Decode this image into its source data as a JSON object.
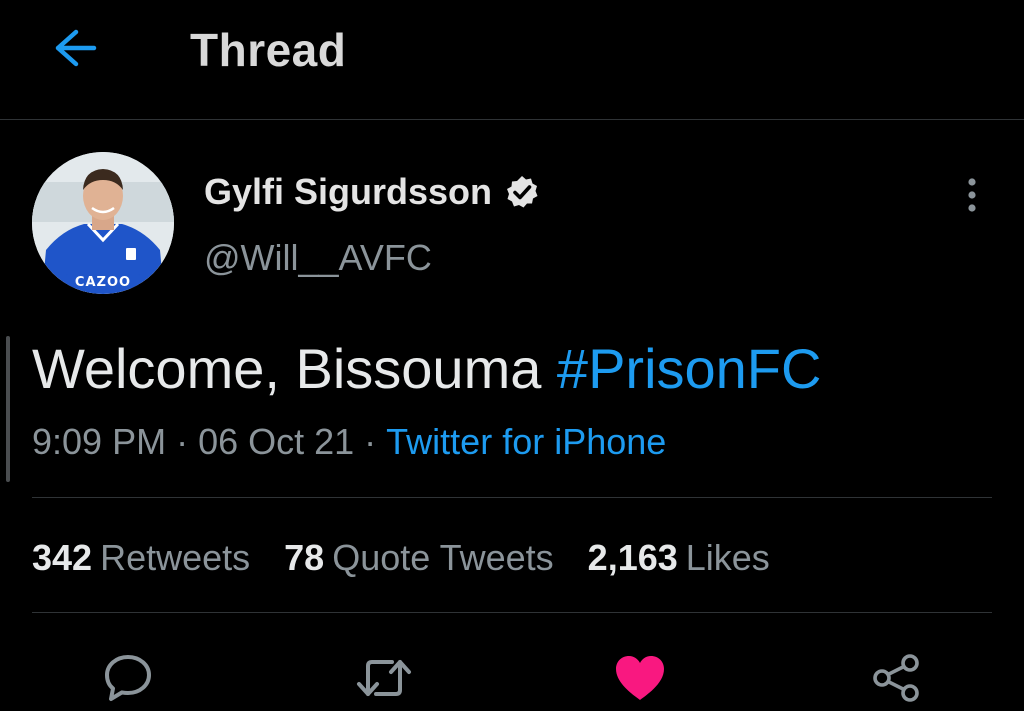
{
  "header": {
    "title": "Thread",
    "back_icon": "arrow-left-icon"
  },
  "tweet": {
    "author": {
      "name": "Gylfi Sigurdsson",
      "handle": "@Will__AVFC",
      "verified": true,
      "avatar_icon": "profile-photo"
    },
    "text": "Welcome, Bissouma ",
    "hashtag": "#PrisonFC",
    "time": "9:09 PM",
    "date": "06 Oct 21",
    "separator": "·",
    "source": "Twitter for iPhone",
    "stats": {
      "retweets": {
        "count": "342",
        "label": "Retweets"
      },
      "quote_tweets": {
        "count": "78",
        "label": "Quote Tweets"
      },
      "likes": {
        "count": "2,163",
        "label": "Likes"
      }
    },
    "liked": true
  },
  "colors": {
    "background": "#000000",
    "accent": "#1d9bf0",
    "muted": "#8b949a",
    "like": "#f91880",
    "divider": "#2f3336"
  }
}
